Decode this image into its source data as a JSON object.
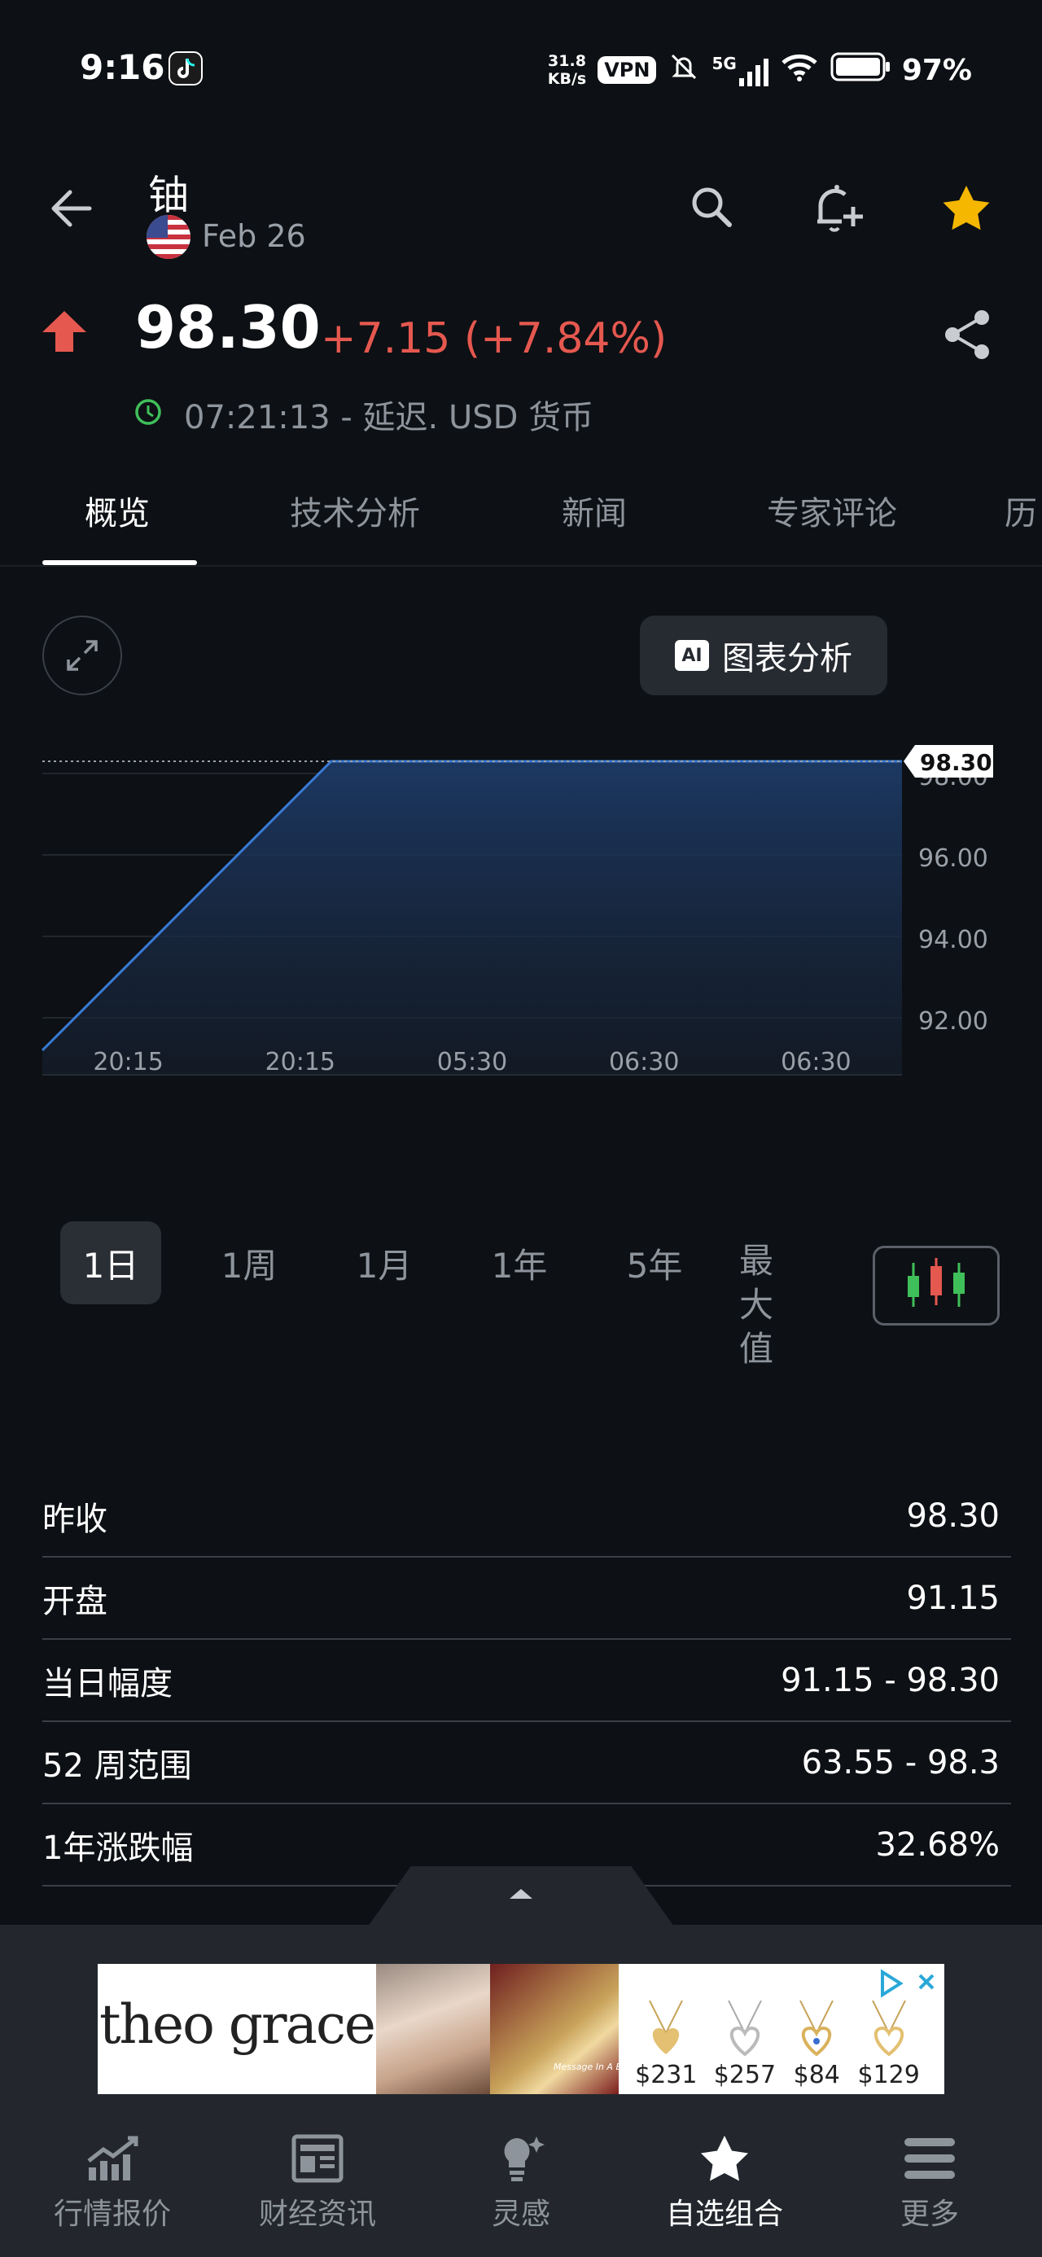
{
  "status_bar": {
    "time": "9:16",
    "net_speed_top": "31.8",
    "net_speed_bottom": "KB/s",
    "vpn": "VPN",
    "network": "5G",
    "battery": "97%"
  },
  "header": {
    "title": "铀",
    "date": "Feb 26"
  },
  "quote": {
    "price": "98.30",
    "change": "+7.15 (+7.84%)",
    "time_note": "07:21:13 - 延迟. USD 货币",
    "up_color": "#e5584f"
  },
  "tabs": [
    {
      "label": "概览"
    },
    {
      "label": "技术分析"
    },
    {
      "label": "新闻"
    },
    {
      "label": "专家评论"
    },
    {
      "label": "历"
    }
  ],
  "chart_controls": {
    "analysis_label": "图表分析",
    "ai_badge": "AI"
  },
  "chart_data": {
    "type": "area",
    "x": [
      "20:15",
      "20:15",
      "05:30",
      "06:30",
      "06:30"
    ],
    "points": [
      [
        0,
        91.2
      ],
      [
        1.68,
        98.3
      ],
      [
        5,
        98.3
      ]
    ],
    "y_ticks": [
      92,
      94,
      96,
      98
    ],
    "y_tick_labels": [
      "92.00",
      "94.00",
      "96.00",
      "98.00"
    ],
    "ylim": [
      90.6,
      98.6
    ],
    "last_value_label": "98.30",
    "line_color": "#3a7bd5",
    "grid": true
  },
  "ranges": [
    {
      "label": "1日"
    },
    {
      "label": "1周"
    },
    {
      "label": "1月"
    },
    {
      "label": "1年"
    },
    {
      "label": "5年"
    },
    {
      "label": "最大值"
    }
  ],
  "stats": [
    {
      "label": "昨收",
      "value": "98.30"
    },
    {
      "label": "开盘",
      "value": "91.15"
    },
    {
      "label": "当日幅度",
      "value": "91.15 - 98.30"
    },
    {
      "label": "52 周范围",
      "value": "63.55 - 98.3"
    },
    {
      "label": "1年涨跌幅",
      "value": "32.68%"
    }
  ],
  "ad": {
    "brand": "theo grace",
    "prices": [
      "$231",
      "$257",
      "$84",
      "$129"
    ],
    "tagline": "Message In A Bottle"
  },
  "bottom_nav": [
    {
      "label": "行情报价",
      "icon": "chart-icon"
    },
    {
      "label": "财经资讯",
      "icon": "news-icon"
    },
    {
      "label": "灵感",
      "icon": "bulb-icon"
    },
    {
      "label": "自选组合",
      "icon": "star-icon"
    },
    {
      "label": "更多",
      "icon": "menu-icon"
    }
  ]
}
